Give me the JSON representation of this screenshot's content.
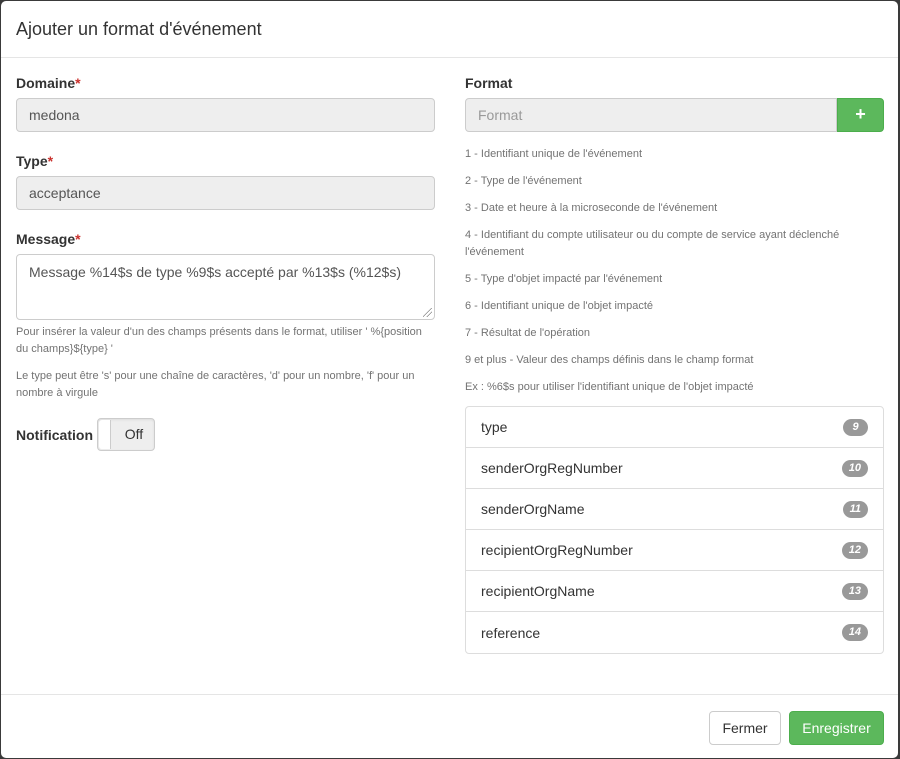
{
  "header": {
    "title": "Ajouter un format d'événement"
  },
  "form": {
    "domain": {
      "label": "Domaine",
      "required_mark": "*",
      "value": "medona"
    },
    "type": {
      "label": "Type",
      "required_mark": "*",
      "value": "acceptance"
    },
    "message": {
      "label": "Message",
      "required_mark": "*",
      "value": "Message %14$s de type %9$s accepté par %13$s (%12$s)",
      "help1": "Pour insérer la valeur d'un des champs présents dans le format, utiliser ' %{position du champs}${type} '",
      "help2": "Le type peut être 's' pour une chaîne de caractères, 'd' pour un nombre, 'f' pour un nombre à virgule"
    },
    "notification": {
      "label": "Notification",
      "state": "Off"
    },
    "format": {
      "label": "Format",
      "placeholder": "Format",
      "add_button": "+",
      "legend": [
        "1 - Identifiant unique de l'événement",
        "2 - Type de l'événement",
        "3 - Date et heure à la microseconde de l'événement",
        "4 - Identifiant du compte utilisateur ou du compte de service ayant déclenché l'événement",
        "5 - Type d'objet impacté par l'événement",
        "6 - Identifiant unique de l'objet impacté",
        "7 - Résultat de l'opération",
        "9 et plus - Valeur des champs définis dans le champ format",
        "Ex : %6$s pour utiliser l'identifiant unique de l'objet impacté"
      ],
      "fields": [
        {
          "name": "type",
          "position": "9"
        },
        {
          "name": "senderOrgRegNumber",
          "position": "10"
        },
        {
          "name": "senderOrgName",
          "position": "11"
        },
        {
          "name": "recipientOrgRegNumber",
          "position": "12"
        },
        {
          "name": "recipientOrgName",
          "position": "13"
        },
        {
          "name": "reference",
          "position": "14"
        }
      ]
    }
  },
  "footer": {
    "close_label": "Fermer",
    "save_label": "Enregistrer"
  }
}
